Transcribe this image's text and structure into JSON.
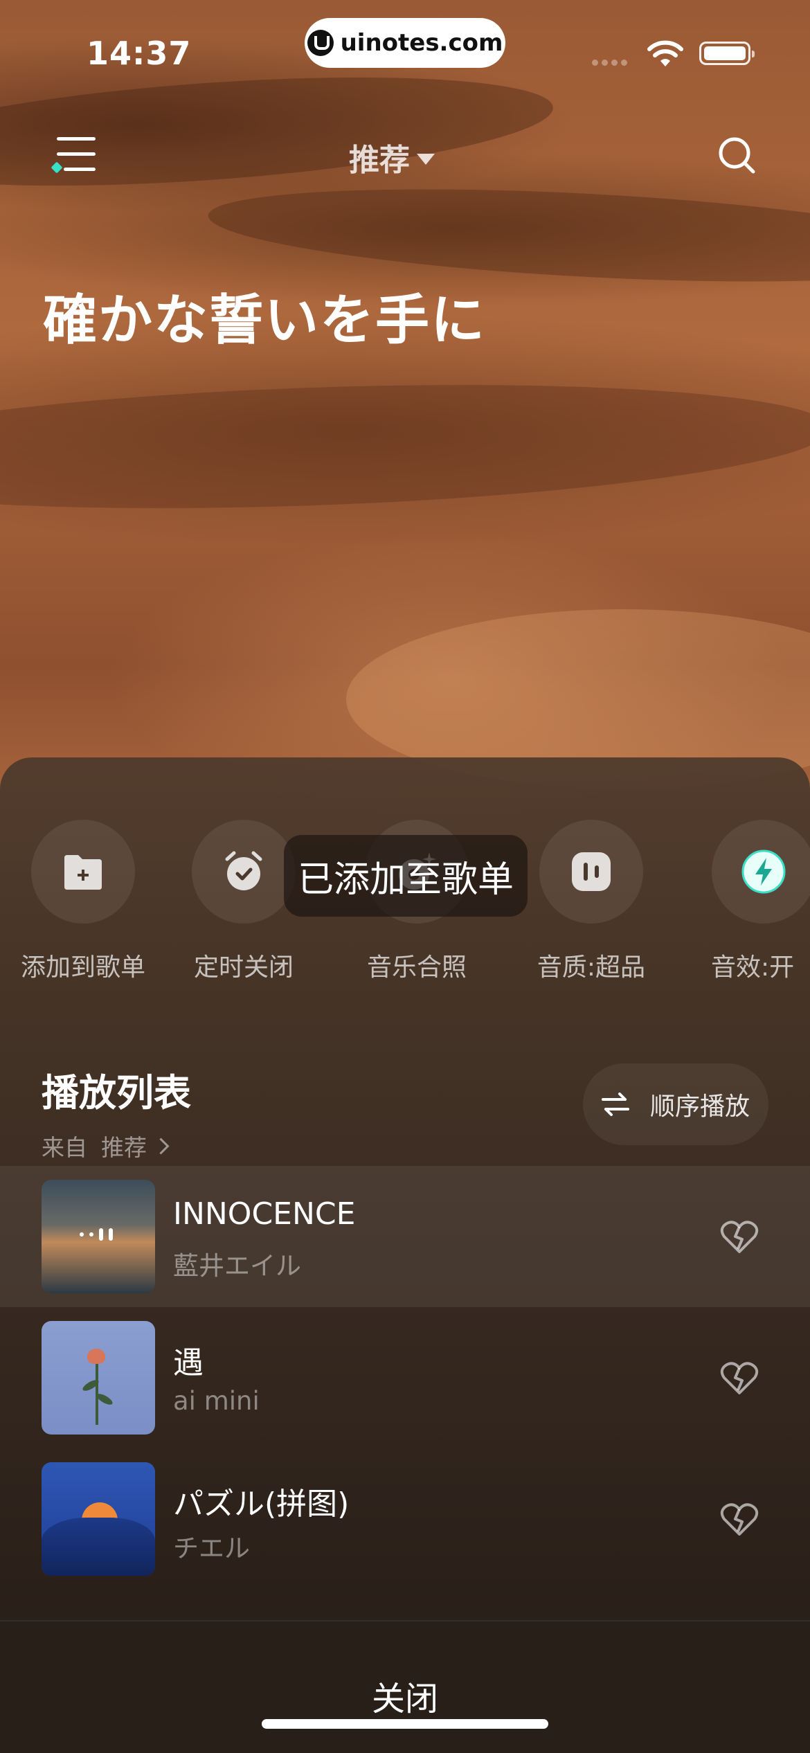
{
  "status_bar": {
    "time": "14:37",
    "url": "uinotes.com"
  },
  "nav": {
    "title": "推荐"
  },
  "now_playing": {
    "title": "確かな誓いを手に"
  },
  "actions": [
    {
      "label": "添加到歌单",
      "icon": "folder-plus-icon"
    },
    {
      "label": "定时关闭",
      "icon": "alarm-clock-icon"
    },
    {
      "label": "音乐合照",
      "icon": "music-photo-icon"
    },
    {
      "label": "音质:超品",
      "icon": "audio-quality-icon"
    },
    {
      "label": "音效:开",
      "icon": "sound-effect-icon"
    }
  ],
  "toast": "已添加至歌单",
  "playlist": {
    "title": "播放列表",
    "source_prefix": "来自",
    "source_name": "推荐",
    "play_mode": "顺序播放",
    "tracks": [
      {
        "name": "INNOCENCE",
        "artist": "藍井エイル",
        "playing": true
      },
      {
        "name": "遇",
        "artist": "ai mini",
        "playing": false
      },
      {
        "name": "パズル(拼图)",
        "artist": "チエル",
        "playing": false
      }
    ]
  },
  "close_label": "关闭",
  "colors": {
    "accent": "#38e0c8",
    "sheet": "#3f3024"
  }
}
